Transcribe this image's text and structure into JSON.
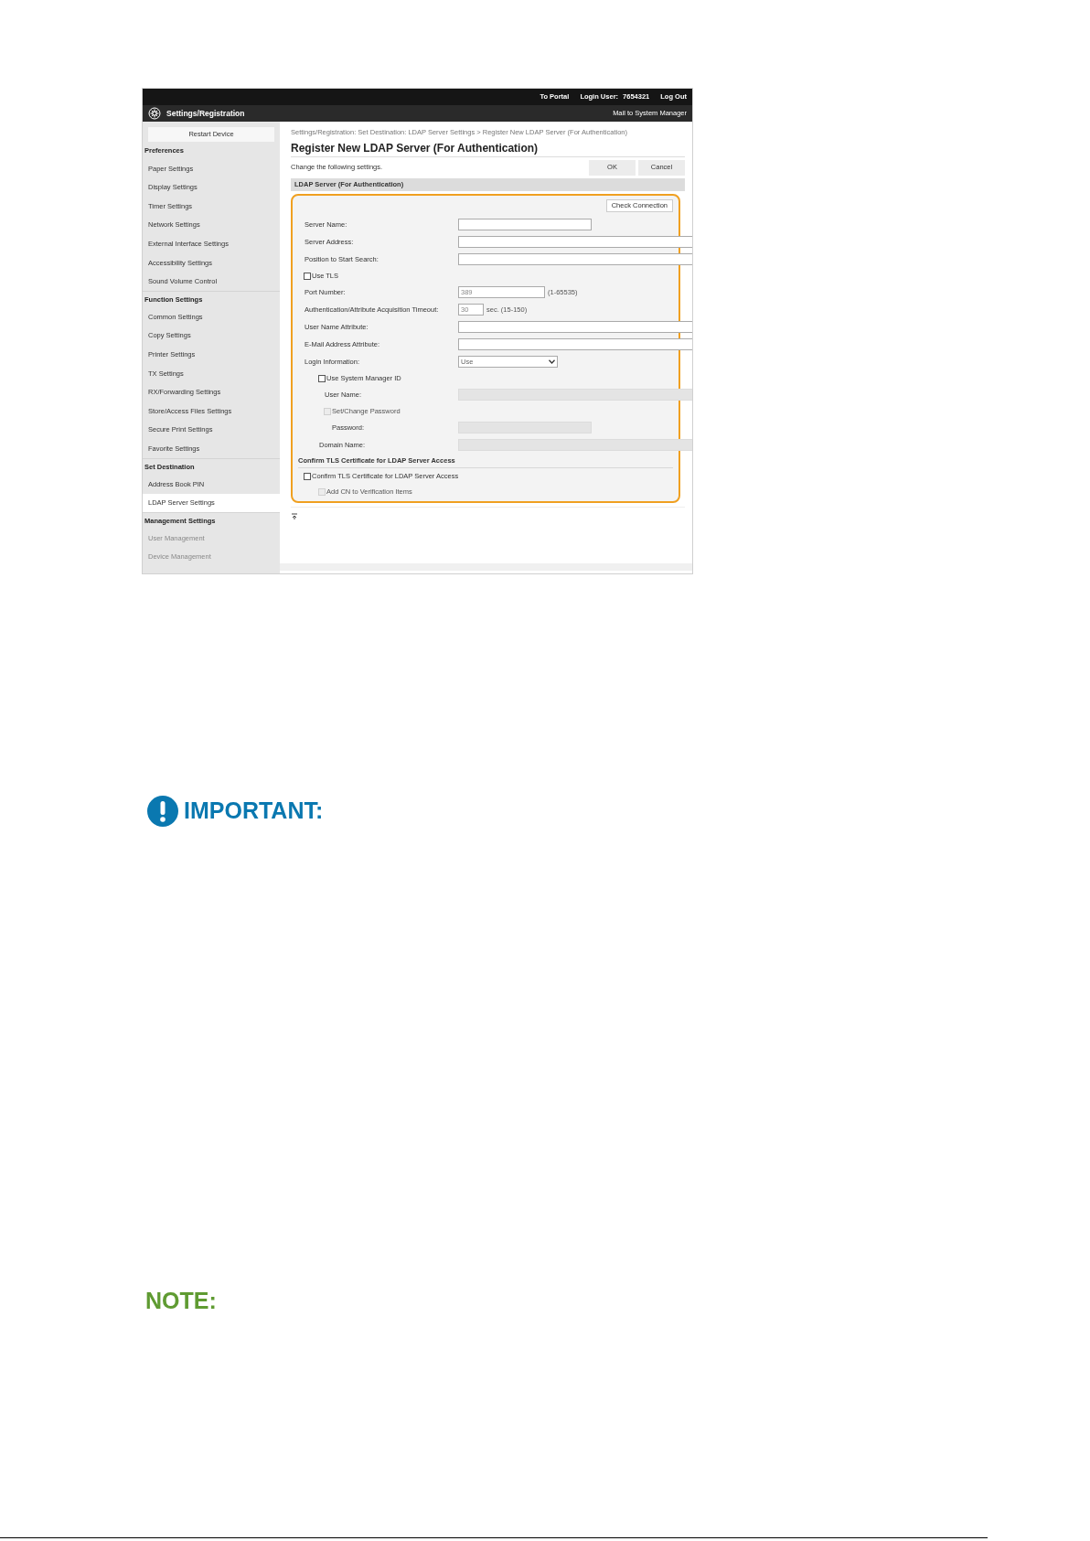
{
  "top_bar": {
    "portal_link": "To Portal",
    "login_label": "Login User:",
    "login_user": "7654321",
    "logout_link": "Log Out"
  },
  "header": {
    "title": "Settings/Registration",
    "mail_link": "Mail to System Manager"
  },
  "sidebar": {
    "restart_button": "Restart Device",
    "sections": [
      {
        "heading": "Preferences",
        "items": [
          {
            "label": "Paper Settings",
            "selected": false
          },
          {
            "label": "Display Settings",
            "selected": false
          },
          {
            "label": "Timer Settings",
            "selected": false
          },
          {
            "label": "Network Settings",
            "selected": false
          },
          {
            "label": "External Interface Settings",
            "selected": false
          },
          {
            "label": "Accessibility Settings",
            "selected": false
          },
          {
            "label": "Sound Volume Control",
            "selected": false
          }
        ]
      },
      {
        "heading": "Function Settings",
        "items": [
          {
            "label": "Common Settings",
            "selected": false
          },
          {
            "label": "Copy Settings",
            "selected": false
          },
          {
            "label": "Printer Settings",
            "selected": false
          },
          {
            "label": "TX Settings",
            "selected": false
          },
          {
            "label": "RX/Forwarding Settings",
            "selected": false
          },
          {
            "label": "Store/Access Files Settings",
            "selected": false
          },
          {
            "label": "Secure Print Settings",
            "selected": false
          },
          {
            "label": "Favorite Settings",
            "selected": false
          }
        ]
      },
      {
        "heading": "Set Destination",
        "items": [
          {
            "label": "Address Book PIN",
            "selected": false
          },
          {
            "label": "LDAP Server Settings",
            "selected": true
          }
        ]
      },
      {
        "heading": "Management Settings",
        "items": [
          {
            "label": "User Management",
            "selected": false
          },
          {
            "label": "Device Management",
            "selected": false
          }
        ]
      }
    ]
  },
  "breadcrumb": "Settings/Registration: Set Destination: LDAP Server Settings > Register New LDAP Server (For Authentication)",
  "page_title": "Register New LDAP Server (For Authentication)",
  "instruction": "Change the following settings.",
  "buttons": [
    "OK",
    "Cancel"
  ],
  "section_title": "LDAP Server (For Authentication)",
  "check_connection_button": "Check Connection",
  "fields": [
    {
      "kind": "short-text",
      "label": "Server Name:",
      "disabled": false
    },
    {
      "kind": "text",
      "label": "Server Address:",
      "disabled": false
    },
    {
      "kind": "text",
      "label": "Position to Start Search:",
      "disabled": false
    },
    {
      "kind": "checkbox",
      "label": "Use TLS",
      "checked": false,
      "disabled": false
    },
    {
      "kind": "number",
      "label": "Port Number:",
      "value": "389",
      "hint": "(1-65535)",
      "disabled": false
    },
    {
      "kind": "tiny-number",
      "label": "Authentication/Attribute Acquisition Timeout:",
      "value": "30",
      "hint": "sec. (15-150)",
      "disabled": false
    },
    {
      "kind": "text",
      "label": "User Name Attribute:",
      "disabled": false
    },
    {
      "kind": "text",
      "label": "E-Mail Address Attribute:",
      "disabled": false
    },
    {
      "kind": "select",
      "label": "Login Information:",
      "value": "Use",
      "disabled": false,
      "children": [
        {
          "kind": "checkbox",
          "label": "Use System Manager ID",
          "checked": false,
          "disabled": false,
          "children": [
            {
              "kind": "text",
              "label": "User Name:",
              "disabled": true
            },
            {
              "kind": "checkbox",
              "label": "Set/Change Password",
              "checked": false,
              "disabled": true,
              "children": [
                {
                  "kind": "short-text",
                  "label": "Password:",
                  "disabled": true
                }
              ]
            }
          ]
        },
        {
          "kind": "text",
          "label": "Domain Name:",
          "disabled": true
        }
      ]
    }
  ],
  "tls_section": {
    "title": "Confirm TLS Certificate for LDAP Server Access",
    "options": [
      {
        "kind": "checkbox",
        "label": "Confirm TLS Certificate for LDAP Server Access",
        "checked": false,
        "disabled": false,
        "children": [
          {
            "kind": "checkbox",
            "label": "Add CN to Verification Items",
            "checked": false,
            "disabled": true
          }
        ]
      }
    ]
  },
  "important_heading": "IMPORTANT:",
  "note_heading": "NOTE:"
}
